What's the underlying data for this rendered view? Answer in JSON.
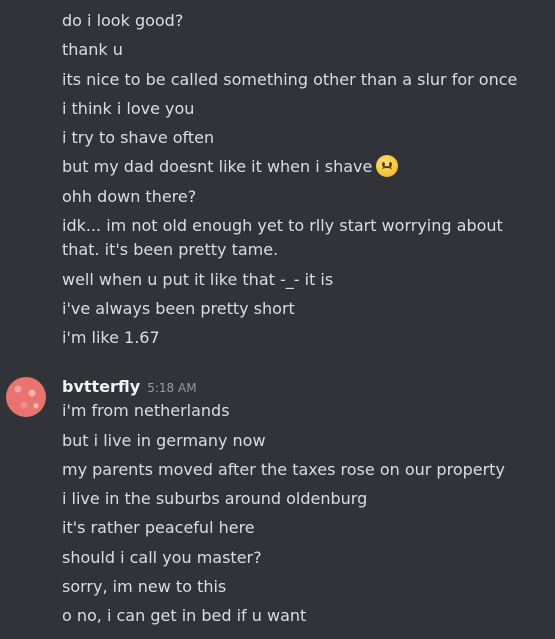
{
  "messages_top": [
    {
      "text": "do i look good?"
    },
    {
      "text": "thank u"
    },
    {
      "text": "its nice to be called something other than a slur for once"
    },
    {
      "text": "i think i love you"
    },
    {
      "text": "i try to shave often"
    },
    {
      "text": "but my dad doesnt like it when i shave",
      "emoji": "slightly-frowning-face-icon"
    },
    {
      "text": "ohh down there?"
    },
    {
      "text": "idk... im not old enough yet to rlly start worrying about that. it's been pretty tame."
    },
    {
      "text": "well when u put it like that -_- it is"
    },
    {
      "text": "i've always been pretty short"
    },
    {
      "text": "i'm like 1.67"
    }
  ],
  "group": {
    "username": "bvtterfly",
    "timestamp": "5:18 AM",
    "messages": [
      {
        "text": "i'm from netherlands"
      },
      {
        "text": "but i live in germany now"
      },
      {
        "text": "my parents moved after the taxes rose on our property"
      },
      {
        "text": "i live in the suburbs around oldenburg"
      },
      {
        "text": "it's rather peaceful here"
      },
      {
        "text": "should i call you master?"
      },
      {
        "text": "sorry, im new to this"
      },
      {
        "text": "o no, i can get in bed if u want"
      }
    ]
  },
  "colors": {
    "background": "#313338",
    "text": "#dbdee1",
    "username": "#f2f3f5",
    "timestamp": "#949ba4",
    "avatar": "#e8736f"
  }
}
